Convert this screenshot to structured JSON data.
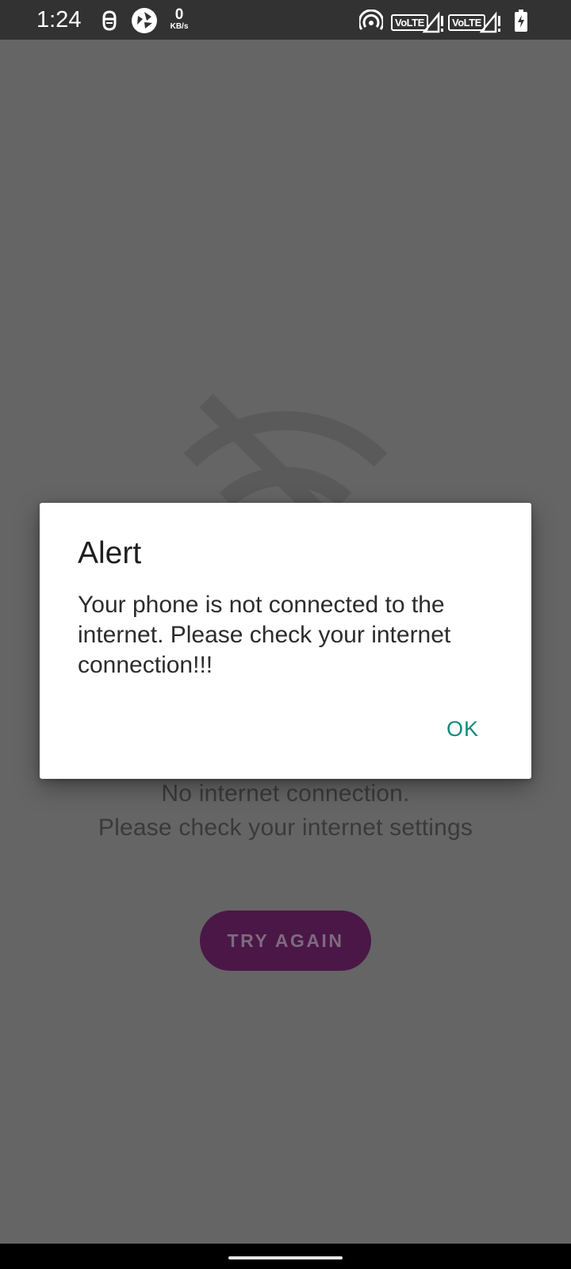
{
  "status_bar": {
    "time": "1:24",
    "speed_value": "0",
    "speed_unit": "KB/s",
    "volte_1": "VoLTE",
    "volte_2": "VoLTE",
    "icons": [
      "face-notification-icon",
      "aperture-icon",
      "hotspot-icon",
      "signal-icon",
      "signal-icon",
      "battery-charging-icon"
    ]
  },
  "background": {
    "icon": "wifi-off-icon",
    "message_line1": "No internet connection.",
    "message_line2": "Please check your internet settings",
    "try_again_label": "TRY AGAIN"
  },
  "dialog": {
    "title": "Alert",
    "message": "Your phone is not connected to the internet. Please check your internet connection!!!",
    "ok_label": "OK"
  },
  "colors": {
    "scrim": "#656565",
    "status_bar": "#323232",
    "accent": "#0f8a80",
    "try_again_button": "#4a1747"
  }
}
